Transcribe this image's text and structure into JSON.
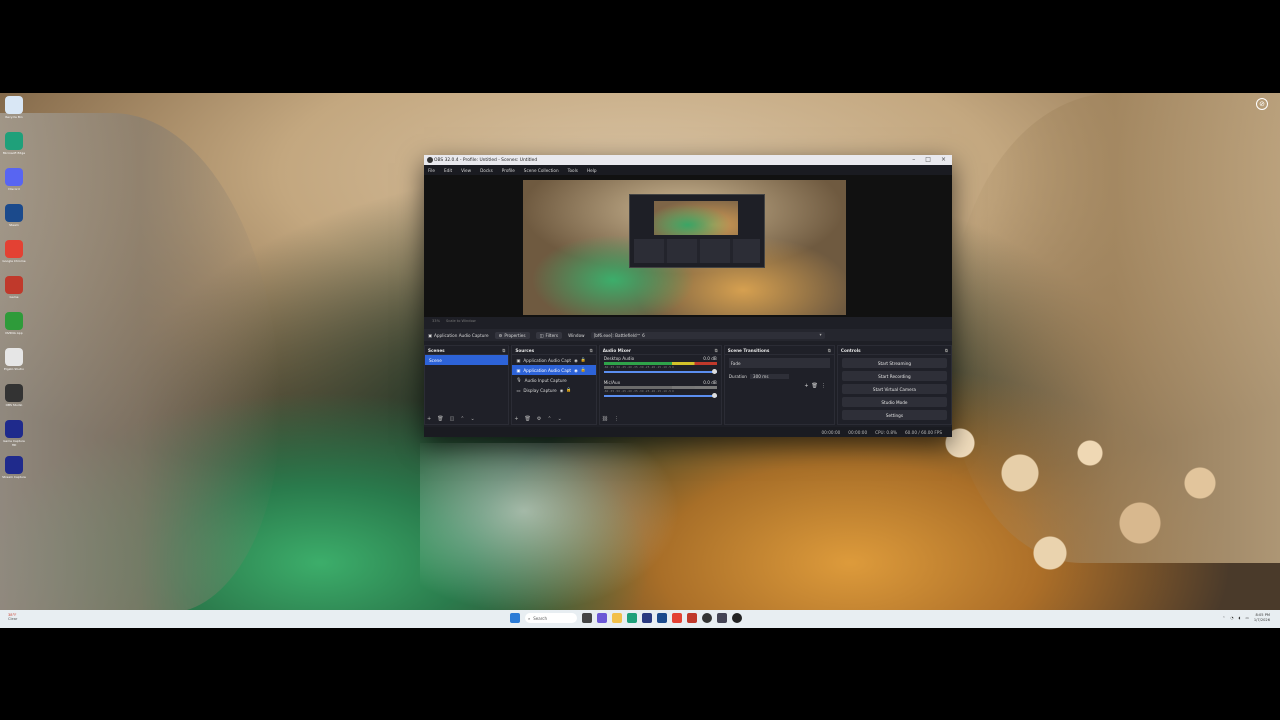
{
  "desktop": {
    "icons": [
      {
        "name": "recycle-bin",
        "label": "Recycle Bin",
        "color": "#d9e7f5"
      },
      {
        "name": "edge",
        "label": "Microsoft Edge",
        "color": "#1fa07a"
      },
      {
        "name": "discord",
        "label": "Discord",
        "color": "#5865f2"
      },
      {
        "name": "steam",
        "label": "Steam",
        "color": "#1b4a8c"
      },
      {
        "name": "chrome",
        "label": "Google Chrome",
        "color": "#e34133"
      },
      {
        "name": "game",
        "label": "Game",
        "color": "#c0392b"
      },
      {
        "name": "nvidia",
        "label": "NVIDIA App",
        "color": "#2e9b3a"
      },
      {
        "name": "file",
        "label": "Elgato Studio",
        "color": "#e6e6e6"
      },
      {
        "name": "obs",
        "label": "OBS Studio",
        "color": "#333"
      },
      {
        "name": "capture",
        "label": "Game Capture HD",
        "color": "#1f2a8c"
      },
      {
        "name": "4k",
        "label": "Stream Capture",
        "color": "#1f2a8c"
      }
    ]
  },
  "obs": {
    "title": "OBS 32.0.4 - Profile: Untitled - Scenes: Untitled",
    "menu": [
      "File",
      "Edit",
      "View",
      "Docks",
      "Profile",
      "Scene Collection",
      "Tools",
      "Help"
    ],
    "preview_zoom": [
      "33%",
      "Scale to Window"
    ],
    "toolbar": {
      "source_name": "Application Audio Capture",
      "properties": "Properties",
      "filters": "Filters",
      "window_label": "Window",
      "window_value": "[bf6.exe]: Battlefield™ 6"
    },
    "scenes": {
      "title": "Scenes",
      "items": [
        "Scene"
      ]
    },
    "sources": {
      "title": "Sources",
      "items": [
        "Application Audio Capt",
        "Application Audio Capt",
        "Audio Input Capture",
        "Display Capture"
      ]
    },
    "mixer": {
      "title": "Audio Mixer",
      "channels": [
        {
          "name": "Desktop Audio",
          "db": "0.0 dB"
        },
        {
          "name": "Mic/Aux",
          "db": "0.0 dB"
        }
      ],
      "ticks": "-60 -55 -50 -45 -40 -35 -30 -25 -20 -15 -10 -5 0"
    },
    "transitions": {
      "title": "Scene Transitions",
      "type": "Fade",
      "duration_label": "Duration",
      "duration": "300 ms"
    },
    "controls": {
      "title": "Controls",
      "buttons": [
        "Start Streaming",
        "Start Recording",
        "Start Virtual Camera",
        "Studio Mode",
        "Settings"
      ]
    },
    "status": {
      "stream_time": "00:00:00",
      "record_time": "00:00:00",
      "cpu": "CPU: 0.8%",
      "fps": "60.00 / 60.00 FPS"
    }
  },
  "taskbar": {
    "weather_line1": "38°F",
    "weather_line2": "Clear",
    "search_placeholder": "Search",
    "time": "8:05 PM",
    "date": "1/7/2026"
  }
}
